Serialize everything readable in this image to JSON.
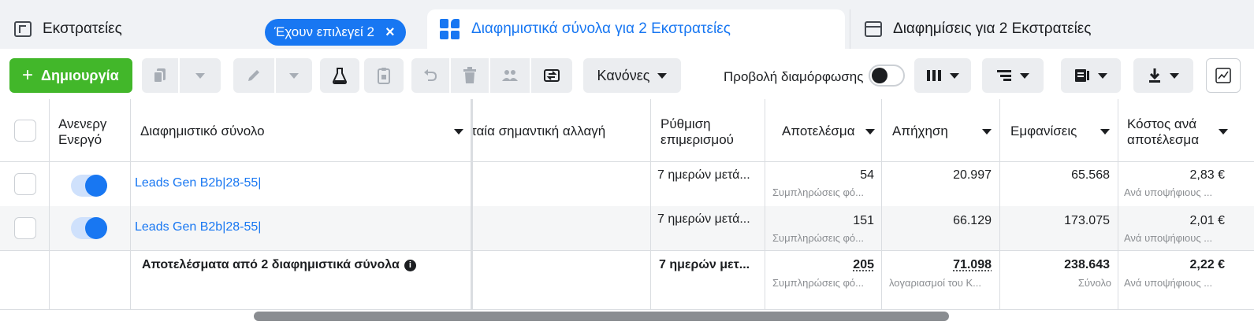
{
  "tabs": {
    "campaigns": {
      "label": "Εκστρατείες",
      "selected_chip": "Έχουν επιλεγεί 2",
      "chip_close": "×"
    },
    "adsets": {
      "label": "Διαφημιστικά σύνολα για 2 Εκστρατείες",
      "active": true
    },
    "ads": {
      "label": "Διαφημίσεις για 2 Εκστρατείες"
    }
  },
  "toolbar": {
    "create_label": "Δημιουργία",
    "create_plus": "+",
    "rules_label": "Κανόνες",
    "view_setup_label": "Προβολή διαμόρφωσης",
    "view_setup_enabled": false
  },
  "table": {
    "headers": {
      "on_off": "Ανενεργ Ενεργό",
      "adset": "Διαφημιστικό σύνολο",
      "last_change": "ταία σημαντική αλλαγή",
      "attribution": "Ρύθμιση επιμερισμού",
      "results": "Αποτελέσμα",
      "reach": "Απήχηση",
      "impressions": "Εμφανίσεις",
      "cost_per_result": "Κόστος ανά αποτέλεσμα"
    },
    "rows": [
      {
        "enabled": true,
        "name": "Leads Gen B2b|28-55|",
        "attribution": "7 ημερών μετά...",
        "results": "54",
        "results_sub": "Συμπληρώσεις φό...",
        "reach": "20.997",
        "impressions": "65.568",
        "cost_per_result": "2,83 €",
        "cost_sub": "Ανά υποψήφιους ..."
      },
      {
        "enabled": true,
        "name": "Leads Gen B2b|28-55|",
        "attribution": "7 ημερών μετά...",
        "results": "151",
        "results_sub": "Συμπληρώσεις φό...",
        "reach": "66.129",
        "impressions": "173.075",
        "cost_per_result": "2,01 €",
        "cost_sub": "Ανά υποψήφιους ..."
      }
    ],
    "summary": {
      "label": "Αποτελέσματα από 2 διαφημιστικά σύνολα",
      "attribution": "7 ημερών μετ...",
      "results": "205",
      "results_sub": "Συμπληρώσεις φό...",
      "reach": "71.098",
      "reach_sub": "λογαριασμοί του Κ...",
      "impressions": "238.643",
      "impressions_sub": "Σύνολο",
      "cost_per_result": "2,22 €",
      "cost_sub": "Ανά υποψήφιους ..."
    }
  },
  "colors": {
    "accent": "#1877f2",
    "create_green": "#42b72a",
    "tabbar_bg": "#f0f2f5",
    "row_alt_bg": "#f5f6f7"
  }
}
